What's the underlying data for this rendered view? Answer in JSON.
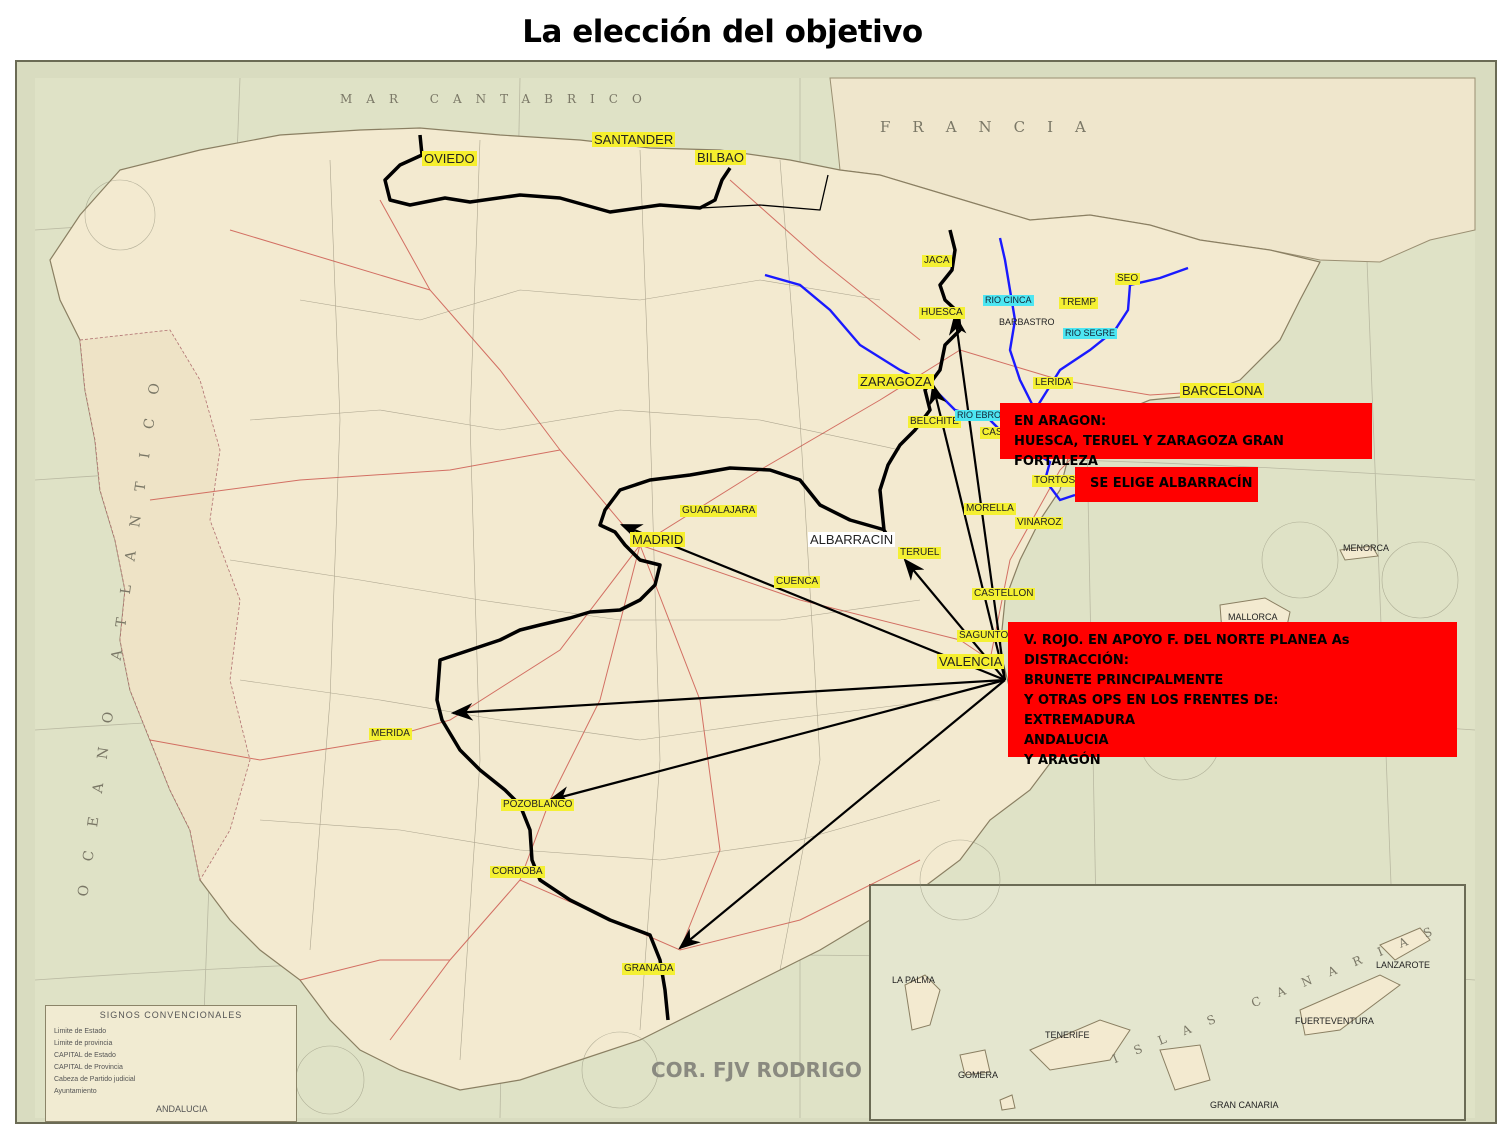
{
  "title": "La elección del objetivo",
  "credit": "COR. FJV RODRIGO",
  "cities": [
    {
      "id": "oviedo",
      "label": "OVIEDO"
    },
    {
      "id": "santander",
      "label": "SANTANDER"
    },
    {
      "id": "bilbao",
      "label": "BILBAO"
    },
    {
      "id": "jaca",
      "label": "JACA"
    },
    {
      "id": "huesca",
      "label": "HUESCA"
    },
    {
      "id": "zaragoza",
      "label": "ZARAGOZA"
    },
    {
      "id": "belchite",
      "label": "BELCHITE"
    },
    {
      "id": "madrid",
      "label": "MADRID"
    },
    {
      "id": "guadalajara",
      "label": "GUADALAJARA"
    },
    {
      "id": "albarracin",
      "label": "ALBARRACIN"
    },
    {
      "id": "teruel",
      "label": "TERUEL"
    },
    {
      "id": "cuenca",
      "label": "CUENCA"
    },
    {
      "id": "castellon",
      "label": "CASTELLON"
    },
    {
      "id": "sagunto",
      "label": "SAGUNTO"
    },
    {
      "id": "valencia",
      "label": "VALENCIA"
    },
    {
      "id": "merida",
      "label": "MERIDA"
    },
    {
      "id": "pozoblanco",
      "label": "POZOBLANCO"
    },
    {
      "id": "cordoba",
      "label": "CORDOBA"
    },
    {
      "id": "granada",
      "label": "GRANADA"
    },
    {
      "id": "tremp",
      "label": "TREMP"
    },
    {
      "id": "seo",
      "label": "SEO"
    },
    {
      "id": "barbastro",
      "label": "BARBASTRO"
    },
    {
      "id": "lerida",
      "label": "LERIDA"
    },
    {
      "id": "barcelona",
      "label": "BARCELONA"
    },
    {
      "id": "tortosa",
      "label": "TORTOSA"
    },
    {
      "id": "morella",
      "label": "MORELLA"
    },
    {
      "id": "vinaroz",
      "label": "VINAROZ"
    },
    {
      "id": "caspe",
      "label": "CASPE"
    }
  ],
  "rivers": [
    {
      "id": "cinca",
      "label": "RIO CINCA"
    },
    {
      "id": "segre",
      "label": "RIO SEGRE"
    },
    {
      "id": "ebro",
      "label": "RIO EBRO"
    }
  ],
  "map_text": {
    "francia": "FRANCIA",
    "cantabrico": "MAR CANTABRICO",
    "atlantico": "OCEANO ATLANTICO",
    "canarias": "ISLAS CANARIAS",
    "menorca": "MENORCA",
    "mallorca": "MALLORCA",
    "la_palma": "LA PALMA",
    "tenerife": "TENERIFE",
    "fuerteventura": "FUERTEVENTURA",
    "lanzarote": "LANZAROTE",
    "gran_canaria": "GRAN CANARIA",
    "gomera": "GOMERA",
    "andalucia": "ANDALUCIA"
  },
  "legend": {
    "title": "SIGNOS CONVENCIONALES",
    "rows": [
      "Limite de Estado",
      "Limite de provincia",
      "CAPITAL de Estado",
      "CAPITAL de Provincia",
      "Cabeza de Partido judicial",
      "Ayuntamiento"
    ]
  },
  "boxes": {
    "aragon": {
      "lines": [
        "EN ARAGON:",
        "HUESCA, TERUEL Y ZARAGOZA GRAN FORTALEZA"
      ]
    },
    "albarracin": {
      "lines": [
        "SE ELIGE ALBARRACÍN"
      ]
    },
    "plan": {
      "lines": [
        "V. ROJO. EN APOYO F. DEL NORTE PLANEA As DISTRACCIÓN:",
        "BRUNETE PRINCIPALMENTE",
        "Y OTRAS OPS EN LOS FRENTES DE:",
        "EXTREMADURA",
        "ANDALUCIA",
        "Y  ARAGÓN"
      ]
    }
  },
  "colors": {
    "front_line": "#000000",
    "river": "#1a1aff",
    "box": "#ff0000",
    "city_highlight": "#f4f033",
    "river_highlight": "#4de6f2"
  }
}
